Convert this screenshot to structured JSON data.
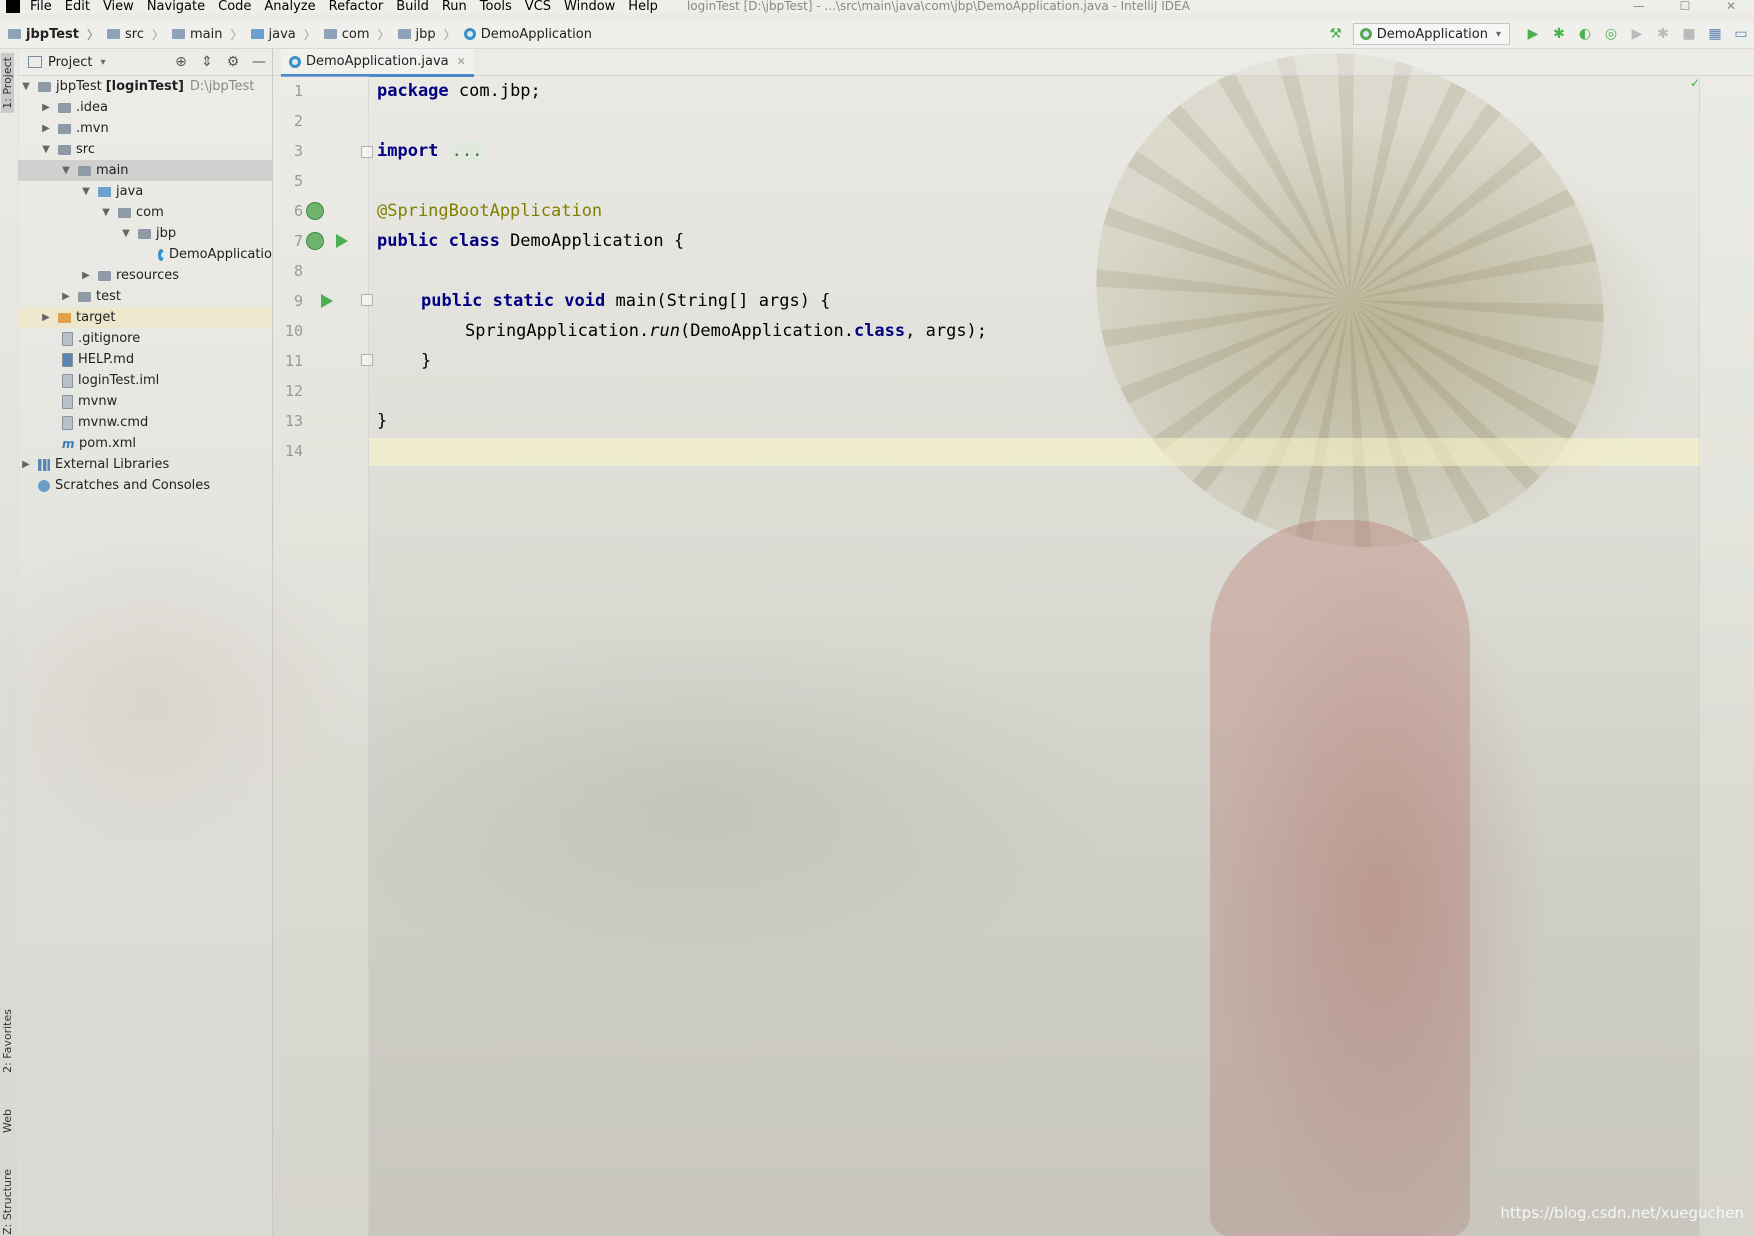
{
  "menu": {
    "items": [
      "File",
      "Edit",
      "View",
      "Navigate",
      "Code",
      "Analyze",
      "Refactor",
      "Build",
      "Run",
      "Tools",
      "VCS",
      "Window",
      "Help"
    ],
    "window_title": "loginTest [D:\\jbpTest] - ...\\src\\main\\java\\com\\jbp\\DemoApplication.java - IntelliJ IDEA"
  },
  "nav": {
    "crumbs": [
      "jbpTest",
      "src",
      "main",
      "java",
      "com",
      "jbp",
      "DemoApplication"
    ],
    "run_config": "DemoApplication"
  },
  "stripe": {
    "project": "1: Project",
    "favorites": "2: Favorites",
    "web": "Web",
    "structure": "Z: Structure"
  },
  "project_panel": {
    "title": "Project",
    "root_name": "jbpTest",
    "root_module": "[loginTest]",
    "root_path": "D:\\jbpTest",
    "items": {
      "idea": ".idea",
      "mvn": ".mvn",
      "src": "src",
      "main": "main",
      "java": "java",
      "com": "com",
      "jbp": "jbp",
      "demo": "DemoApplicatio",
      "resources": "resources",
      "test": "test",
      "target": "target",
      "gitignore": ".gitignore",
      "help": "HELP.md",
      "iml": "loginTest.iml",
      "mvnw": "mvnw",
      "mvnwcmd": "mvnw.cmd",
      "pom": "pom.xml",
      "libs": "External Libraries",
      "scratches": "Scratches and Consoles"
    }
  },
  "editor": {
    "tab": "DemoApplication.java",
    "line_numbers": [
      "1",
      "2",
      "3",
      "5",
      "6",
      "7",
      "8",
      "9",
      "10",
      "11",
      "12",
      "13",
      "14"
    ],
    "code": {
      "l1_kw": "package",
      "l1_rest": " com.jbp;",
      "l3_kw": "import",
      "l3_dots": "...",
      "l6": "@SpringBootApplication",
      "l7_kw": "public class",
      "l7_rest": " DemoApplication {",
      "l9_kw": "public static void",
      "l9_rest": " main(String[] args) {",
      "l10_a": "SpringApplication.",
      "l10_b": "run",
      "l10_c": "(DemoApplication.",
      "l10_d": "class",
      "l10_e": ", args);",
      "l11": "}",
      "l13": "}"
    }
  },
  "watermark": "https://blog.csdn.net/xueguchen"
}
